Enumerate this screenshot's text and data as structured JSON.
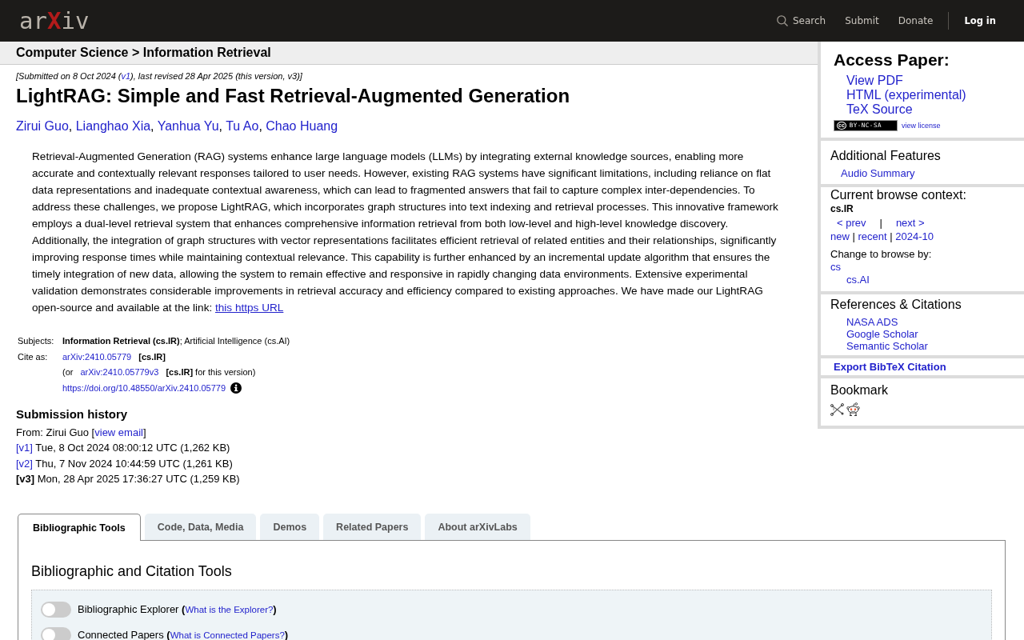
{
  "header": {
    "logo": "arXiv",
    "nav": [
      {
        "kind": "search",
        "label": "Search"
      },
      {
        "kind": "link",
        "label": "Submit"
      },
      {
        "kind": "link",
        "label": "Donate"
      },
      {
        "kind": "login",
        "label": "Log in"
      }
    ]
  },
  "breadcrumb": "Computer Science > Information Retrieval",
  "dateline": [
    {
      "kind": "text",
      "text": "[Submitted on 8 Oct 2024 ("
    },
    {
      "kind": "link",
      "text": "v1"
    },
    {
      "kind": "text",
      "text": "), last revised 28 Apr 2025 (this version, v3)]"
    }
  ],
  "title": "LightRAG: Simple and Fast Retrieval-Augmented Generation",
  "authors": [
    {
      "kind": "link",
      "text": "Zirui Guo"
    },
    {
      "kind": "text",
      "text": ", "
    },
    {
      "kind": "link",
      "text": "Lianghao Xia"
    },
    {
      "kind": "text",
      "text": ", "
    },
    {
      "kind": "link",
      "text": "Yanhua Yu"
    },
    {
      "kind": "text",
      "text": ", "
    },
    {
      "kind": "link",
      "text": "Tu Ao"
    },
    {
      "kind": "text",
      "text": ", "
    },
    {
      "kind": "link",
      "text": "Chao Huang"
    }
  ],
  "abstract": [
    {
      "kind": "text",
      "text": "Retrieval-Augmented Generation (RAG) systems enhance large language models (LLMs) by integrating external knowledge sources, enabling more accurate and contextually relevant responses tailored to user needs. However, existing RAG systems have significant limitations, including reliance on flat data representations and inadequate contextual awareness, which can lead to fragmented answers that fail to capture complex inter-dependencies. To address these challenges, we propose LightRAG, which incorporates graph structures into text indexing and retrieval processes. This innovative framework employs a dual-level retrieval system that enhances comprehensive information retrieval from both low-level and high-level knowledge discovery. Additionally, the integration of graph structures with vector representations facilitates efficient retrieval of related entities and their relationships, significantly improving response times while maintaining contextual relevance. This capability is further enhanced by an incremental update algorithm that ensures the timely integration of new data, allowing the system to remain effective and responsive in rapidly changing data environments. Extensive experimental validation demonstrates considerable improvements in retrieval accuracy and efficiency compared to existing approaches. We have made our LightRAG open-source and available at the link: "
    },
    {
      "kind": "link",
      "text": "this https URL"
    }
  ],
  "metadata": [
    {
      "label": "Subjects:",
      "lines": [
        {
          "segments": [
            {
              "kind": "text",
              "text": "**Information Retrieval (cs.IR)**; Artificial Intelligence (cs.AI)"
            }
          ]
        }
      ]
    },
    {
      "label": "Cite as:",
      "lines": [
        {
          "segments": [
            {
              "kind": "link",
              "text": "arXiv:2410.05779"
            },
            {
              "kind": "text",
              "text": " **[cs.IR]**"
            }
          ]
        },
        {
          "segments": [
            {
              "kind": "text",
              "text": "(or "
            },
            {
              "kind": "link",
              "text": "arXiv:2410.05779v3"
            },
            {
              "kind": "text",
              "text": " **[cs.IR]** for this version)"
            }
          ]
        },
        {
          "segments": [
            {
              "kind": "link",
              "text": "https://doi.org/10.48550/arXiv.2410.05779"
            }
          ],
          "info_icon": true
        }
      ]
    }
  ],
  "submission_history": {
    "heading": "Submission history",
    "lines": [
      [
        {
          "kind": "text",
          "text": "From: Zirui Guo ["
        },
        {
          "kind": "link",
          "text": "view email"
        },
        {
          "kind": "text",
          "text": "]"
        }
      ],
      [
        {
          "kind": "link",
          "text": "[v1]"
        },
        {
          "kind": "text",
          "text": " Tue, 8 Oct 2024 08:00:12 UTC (1,262 KB)"
        }
      ],
      [
        {
          "kind": "link",
          "text": "[v2]"
        },
        {
          "kind": "text",
          "text": " Thu, 7 Nov 2024 10:44:59 UTC (1,261 KB)"
        }
      ],
      [
        {
          "kind": "text",
          "text": "**[v3]** Mon, 28 Apr 2025 17:36:27 UTC (1,259 KB)"
        }
      ]
    ]
  },
  "tabs": [
    {
      "label": "Bibliographic Tools",
      "selected": true
    },
    {
      "label": "Code, Data, Media",
      "selected": false
    },
    {
      "label": "Demos",
      "selected": false
    },
    {
      "label": "Related Papers",
      "selected": false
    },
    {
      "label": "About arXivLabs",
      "selected": false
    }
  ],
  "bibliographic_tools": {
    "heading": "Bibliographic and Citation Tools",
    "toggles": [
      {
        "on": false,
        "label": [
          {
            "kind": "text",
            "text": "Bibliographic Explorer **(**"
          },
          {
            "kind": "link",
            "text": "What is the Explorer?"
          },
          {
            "kind": "text",
            "text": "**)**"
          }
        ]
      },
      {
        "on": false,
        "label": [
          {
            "kind": "text",
            "text": "Connected Papers **(**"
          },
          {
            "kind": "link",
            "text": "What is Connected Papers?"
          },
          {
            "kind": "text",
            "text": "**)**"
          }
        ]
      }
    ]
  },
  "sidebar": {
    "access_paper": {
      "title": "Access Paper:",
      "links": [
        "View PDF",
        "HTML (experimental)",
        "TeX Source"
      ],
      "license": {
        "badge": {
          "symbol": "cc",
          "terms": "BY-NC-SA"
        },
        "link": "view license"
      }
    },
    "additional_features": {
      "title": "Additional Features",
      "links": [
        "Audio Summary"
      ]
    },
    "browse_context": {
      "title": "Current browse context:",
      "context": "cs.IR",
      "navigation": [
        {
          "kind": "link",
          "text": "< prev"
        },
        {
          "kind": "text",
          "text": "|"
        },
        {
          "kind": "link",
          "text": "next >"
        }
      ],
      "listings": [
        {
          "kind": "link",
          "text": "new"
        },
        {
          "kind": "text",
          "text": " | "
        },
        {
          "kind": "link",
          "text": "recent"
        },
        {
          "kind": "text",
          "text": " | "
        },
        {
          "kind": "link",
          "text": "2024-10"
        }
      ],
      "change_label": "Change to browse by:",
      "categories": [
        {
          "label": "cs",
          "children": [
            {
              "label": "cs.AI"
            }
          ]
        }
      ]
    },
    "references": {
      "title": "References & Citations",
      "links": [
        "NASA ADS",
        "Google Scholar",
        "Semantic Scholar"
      ]
    },
    "export": {
      "label": "Export BibTeX Citation"
    },
    "bookmark": {
      "title": "Bookmark"
    }
  }
}
